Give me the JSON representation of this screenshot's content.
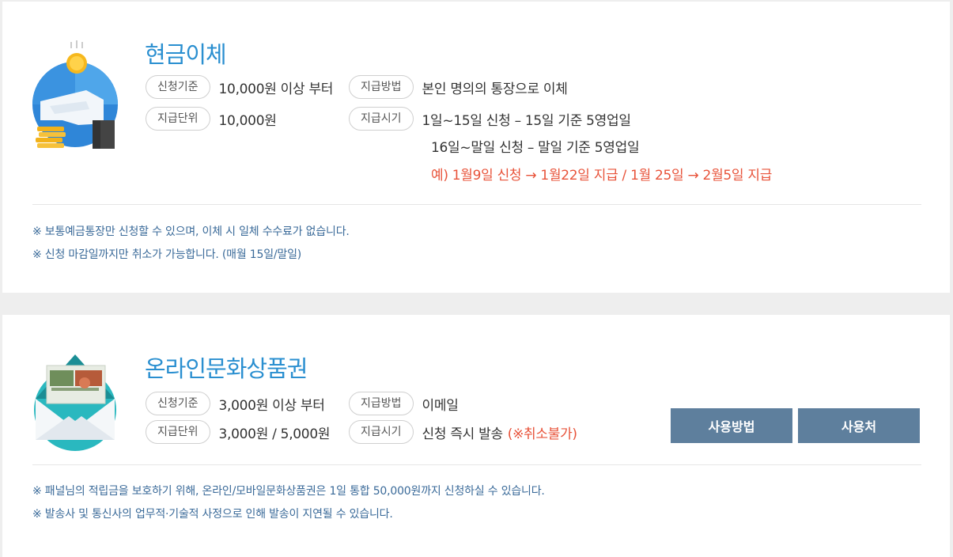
{
  "cash": {
    "title": "현금이체",
    "label_criteria": "신청기준",
    "value_criteria": "10,000원 이상 부터",
    "label_unit": "지급단위",
    "value_unit": "10,000원",
    "label_method": "지급방법",
    "value_method": "본인 명의의 통장으로 이체",
    "label_timing": "지급시기",
    "timing_line1": "1일~15일 신청 – 15일 기준 5영업일",
    "timing_line2": "16일~말일 신청 – 말일 기준 5영업일",
    "timing_example": "예) 1월9일 신청 → 1월22일 지급 / 1월 25일 → 2월5일 지급",
    "notes": [
      "※ 보통예금통장만 신청할 수 있으며, 이체 시 일체 수수료가 없습니다.",
      "※ 신청 마감일까지만 취소가 가능합니다. (매월 15일/말일)"
    ]
  },
  "voucher": {
    "title": "온라인문화상품권",
    "label_criteria": "신청기준",
    "value_criteria": "3,000원 이상 부터",
    "label_unit": "지급단위",
    "value_unit": "3,000원 / 5,000원",
    "label_method": "지급방법",
    "value_method": "이메일",
    "label_timing": "지급시기",
    "value_timing": "신청 즉시 발송",
    "value_timing_note": "(※취소불가)",
    "button_howto": "사용방법",
    "button_where": "사용처",
    "notes": [
      "※ 패널님의 적립금을 보호하기 위해, 온라인/모바일문화상품권은 1일 통합 50,000원까지 신청하실 수 있습니다.",
      "※ 발송사 및 통신사의 업무적·기술적 사정으로 인해 발송이 지연될 수 있습니다."
    ]
  },
  "colors": {
    "title_blue": "#2a8fd0",
    "example_red": "#e8533a",
    "note_blue": "#3a6a99",
    "button_bg": "#5e7f9d"
  },
  "icons": [
    "cash-transfer-icon",
    "voucher-envelope-icon"
  ]
}
